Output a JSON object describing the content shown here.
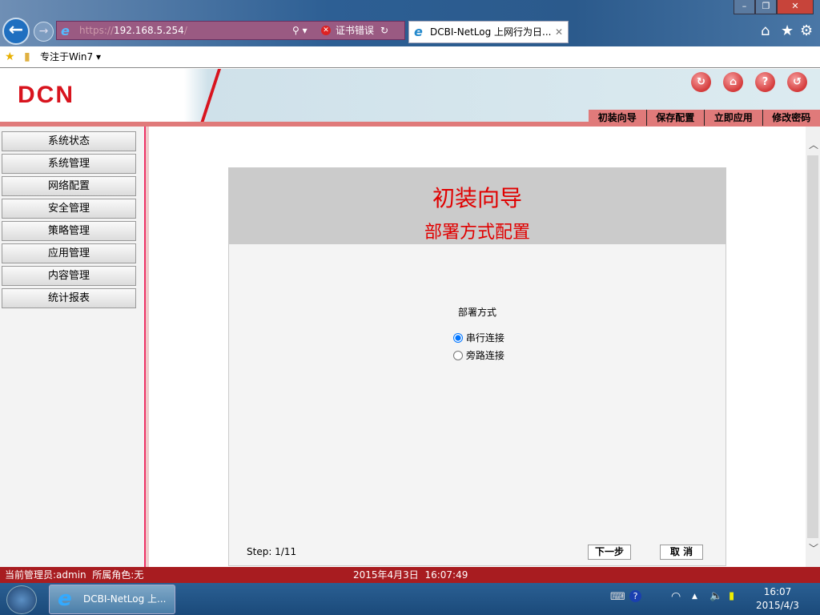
{
  "browser": {
    "url_scheme": "https://",
    "url_host": "192.168.5.254",
    "url_tail": "/",
    "cert_error": "证书错误",
    "tab_title": "DCBI-NetLog 上网行为日...",
    "favorite": "专注于Win7"
  },
  "header": {
    "logo": "DCN",
    "menu": [
      "初装向导",
      "保存配置",
      "立即应用",
      "修改密码"
    ],
    "icons": [
      "refresh-icon",
      "home-icon",
      "help-icon",
      "logout-icon"
    ]
  },
  "sidebar": {
    "items": [
      "系统状态",
      "系统管理",
      "网络配置",
      "安全管理",
      "策略管理",
      "应用管理",
      "内容管理",
      "统计报表"
    ]
  },
  "wizard": {
    "title": "初装向导",
    "subtitle": "部署方式配置",
    "field_label": "部署方式",
    "options": [
      {
        "label": "串行连接",
        "checked": true
      },
      {
        "label": "旁路连接",
        "checked": false
      }
    ],
    "step": "Step: 1/11",
    "next": "下一步",
    "cancel": "取 消"
  },
  "status": {
    "admin": "当前管理员:admin  所属角色:无",
    "datetime": "2015年4月3日  16:07:49"
  },
  "taskbar": {
    "item": "DCBI-NetLog 上...",
    "time": "16:07",
    "date": "2015/4/3"
  }
}
